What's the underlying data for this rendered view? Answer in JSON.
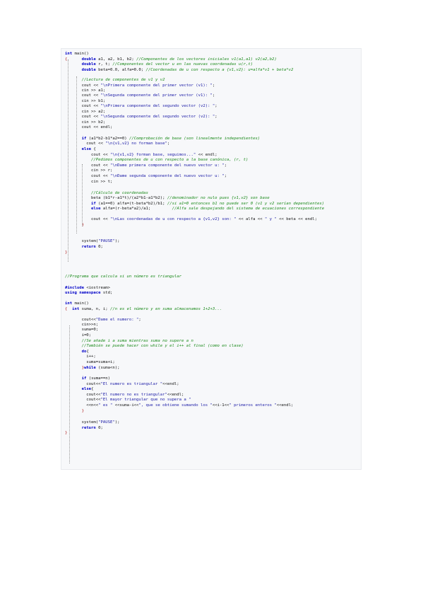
{
  "code": {
    "lines": [
      "int main()",
      "{      double a1, a2, b1, b2; //Componentes de los vectores iniciales v1(a1,a1) v2(a2,b2)",
      "       double r, t; //Componentes del vector u en las nuevas coordenadas u(r,t)",
      "       double beta=0.0, alfa=0.0; //Coordenadas de u con respecto a {v1,v2}: u=alfa*v1 + beta*v2",
      "",
      "       //Lectura de componentes de v1 y v2",
      "       cout << \"\\nPrimera componente del primer vector (v1): \";",
      "       cin >> a1;",
      "       cout << \"\\nSegunda componente del primer vector (v1): \";",
      "       cin >> b1;",
      "       cout << \"\\nPrimera componente del segundo vector (v2): \";",
      "       cin >> a2;",
      "       cout << \"\\nSegunda componente del segundo vector (v2): \";",
      "       cin >> b2;",
      "       cout << endl;",
      "",
      "       if (a1*b2-b1*a2==0) //Comprobación de base (son linealmente independientes)",
      "         cout << \"\\n{v1,v2} no forman base\";",
      "       else {",
      "           cout << \"\\n{v1,v2} forman base, seguimos...\" << endl;",
      "           //Pedimos componentes de u con respecto a la base canónica, (r, t)",
      "           cout << \"\\nDame primera componente del nuevo vector u: \";",
      "           cin >> r;",
      "           cout << \"\\nDame segunda componente del nuevo vector u: \";",
      "           cin >> t;",
      "",
      "           //Cálculo de coordenadas",
      "           beta (b1*r-a1*t)/(a2*b1-a1*b2); //denominador no nulo pues {v1,v2} son base",
      "           if (a1==0) alfa=(t-beta*b2)/b1; //si a1=0 entonces b1 no puede ser 0 (v1 y v2 serían dependientes)",
      "           else alfa=(r-beta*a2)/a1;         //Alfa sale despejando del sistema de ecuaciones correspondiente",
      "",
      "           cout << \"\\nLas coordenadas de u con respecto a {v1,v2} son: \" << alfa << \" y \" << beta << endl;",
      "       }",
      "",
      "",
      "       system(\"PAUSE\");",
      "       return 0;",
      "}",
      "",
      "//Programa que calcula si un número es triangular",
      "",
      "#include <iostream>",
      "using namespace std;",
      "",
      "int main()",
      "{  int suma, n, i; //n es el número y en suma almacenamos 1+2+3...",
      "",
      "       cout<<\"Dame el numero: \";",
      "       cin>>n;",
      "       suma=0;",
      "       i=0;",
      "       //Se añade i a suma mientras suma no supere a n",
      "       //También se puede hacer con while y el i++ al final (como en clase)",
      "       do{",
      "         i++;",
      "         suma=suma+i;",
      "       }while (suma<n);",
      "",
      "       if (suma==n)",
      "         cout<<\"El numero es triangular \"<<endl;",
      "       else{",
      "         cout<<\"El numero no es triangular\"<<endl;",
      "         cout<<\"El mayor triangular que no supera a \"",
      "         <<n<<\" es \" <<suma-i<<\", que se obtiene sumando los \"<<i-1<<\" primeros enteros \"<<endl;",
      "       }",
      "",
      "       system(\"PAUSE\");",
      "       return 0;",
      "}"
    ]
  }
}
